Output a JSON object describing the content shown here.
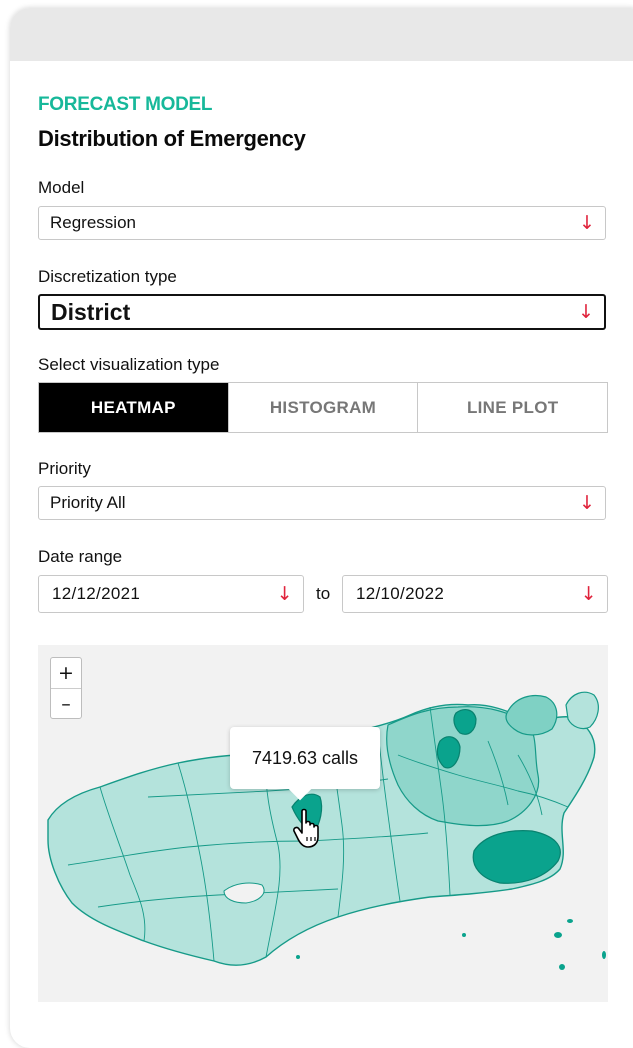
{
  "header": {
    "kicker": "FORECAST MODEL",
    "title": "Distribution of Emergency"
  },
  "model": {
    "label": "Model",
    "value": "Regression"
  },
  "discretization": {
    "label": "Discretization type",
    "value": "District"
  },
  "visualization": {
    "label": "Select visualization type",
    "tabs": [
      "HEATMAP",
      "HISTOGRAM",
      "LINE PLOT"
    ],
    "active": "HEATMAP"
  },
  "priority": {
    "label": "Priority",
    "value": "Priority All"
  },
  "date_range": {
    "label": "Date range",
    "from": "12/12/2021",
    "separator": "to",
    "to": "12/10/2022"
  },
  "map": {
    "zoom_in": "+",
    "zoom_out": "–",
    "tooltip": "7419.63 calls"
  },
  "icons": {
    "dropdown": "↓",
    "cursor": "hand-pointer-icon"
  },
  "colors": {
    "accent": "#17b89a",
    "dropdown_arrow": "#e0233c",
    "map_light": "#b4e3dc",
    "map_mid": "#4fc2b0",
    "map_dark": "#0aa38d",
    "map_stroke": "#169a88"
  }
}
